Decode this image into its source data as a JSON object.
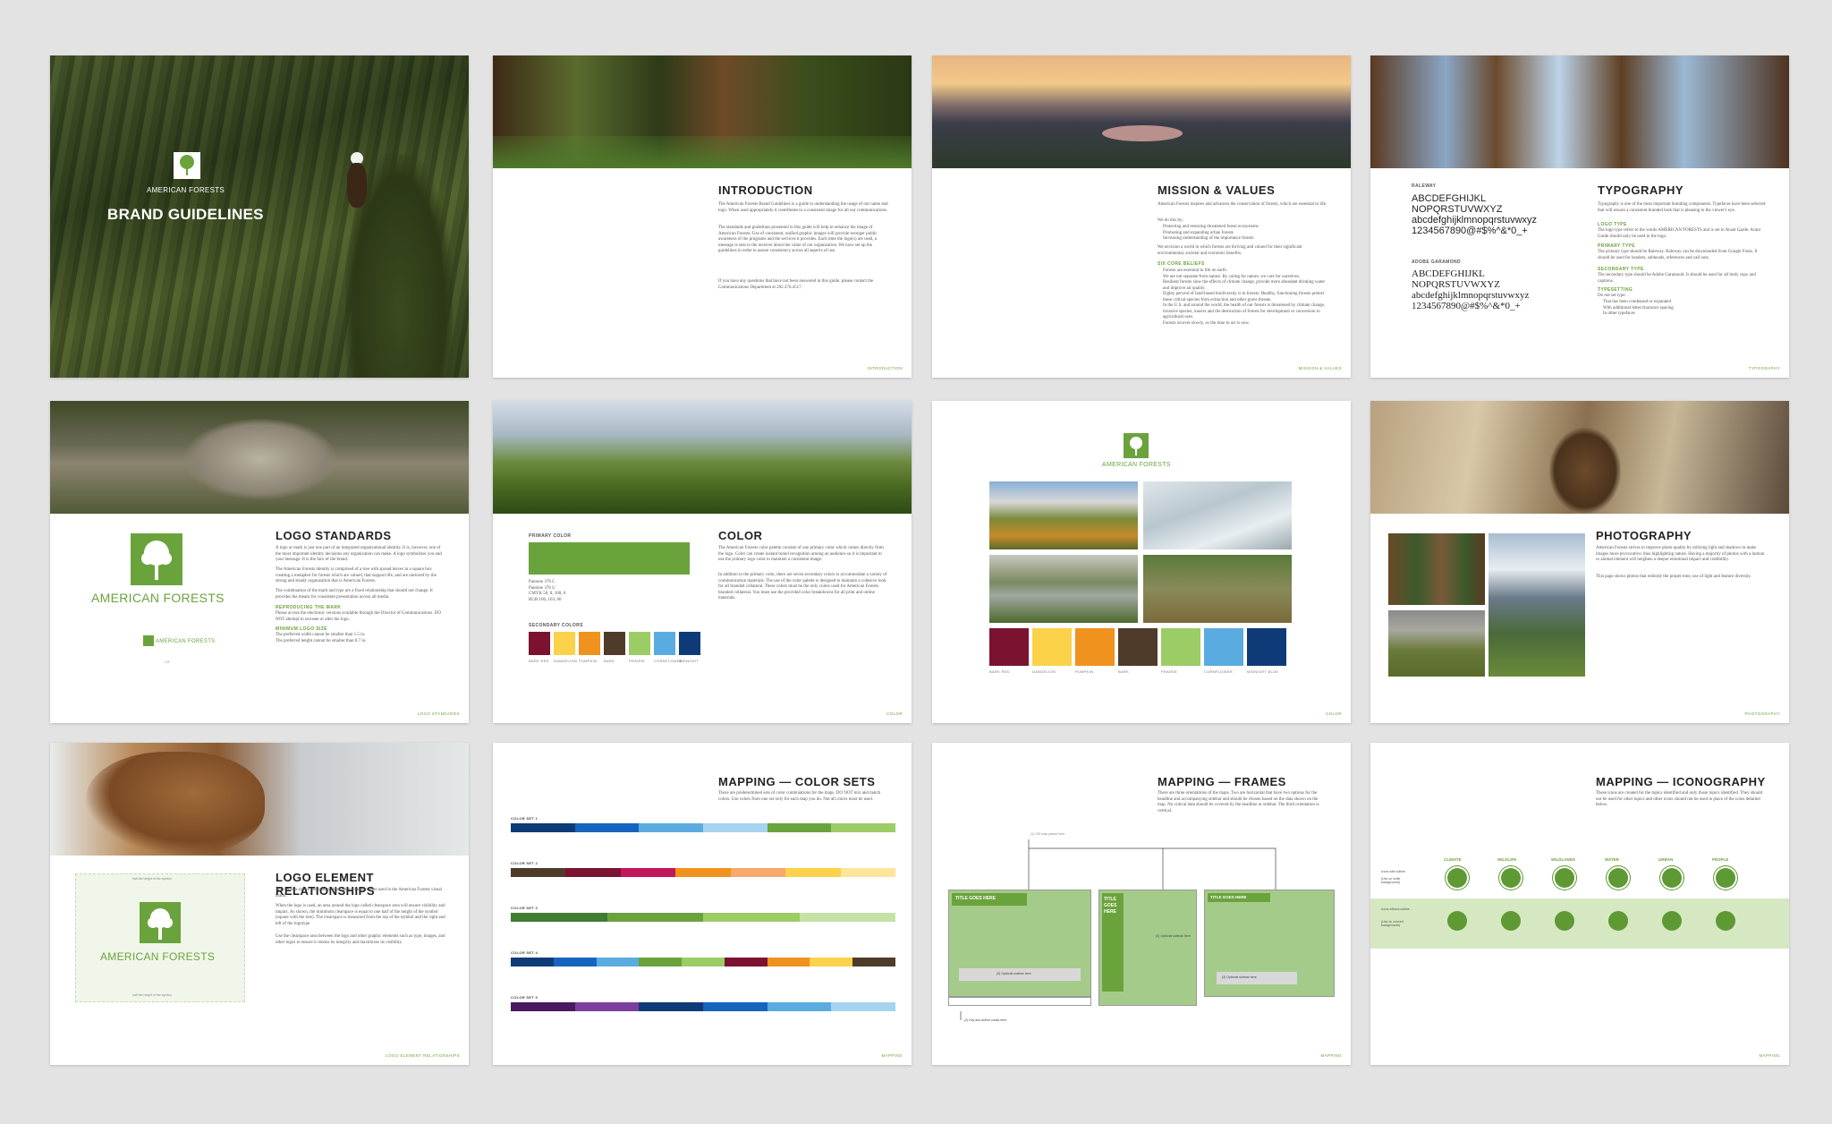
{
  "brand": "AMERICAN FORESTS",
  "cover": {
    "title": "BRAND GUIDELINES"
  },
  "intro": {
    "title": "INTRODUCTION",
    "p1": "The American Forests Brand Guidelines is a guide to understanding the usage of our name and logo. When used appropriately it contributes to a consistent image for all our communications.",
    "p2": "The standards and guidelines presented in this guide will help to enhance the image of American Forests. Use of consistent, unified graphic images will provide stronger public awareness of the programs and the services it provides. Each time the logo(s) are used, a message is sent to the receiver about the value of our organization. We have set up the guidelines in order to assure consistency across all aspects of use.",
    "p3": "If you have any questions that have not been answered in this guide, please contact the Communications Department at 202.370.4517.",
    "foot": "INTRODUCTION"
  },
  "mission": {
    "title": "MISSION & VALUES",
    "p1": "American Forests inspires and advances the conservation of forests, which are essential to life.",
    "p2": "We do this by:",
    "list1": [
      "Protecting and restoring threatened forest ecosystems",
      "Promoting and expanding urban forests",
      "Increasing understanding of the importance forests"
    ],
    "p3": "We envision a world in which forests are thriving and valued for their significant environmental, societal and economic benefits.",
    "beliefs_title": "SIX CORE BELIEFS",
    "beliefs": [
      "Forests are essential to life on earth.",
      "We are not separate from nature. By caring for nature, we care for ourselves.",
      "Resilient forests slow the effects of climate change, provide more abundant drinking water and improve air quality.",
      "Eighty percent of land-based biodiversity is in forests. Healthy, functioning forests protect these critical species from extinction and other grave threats.",
      "In the U.S. and around the world, the health of our forests is threatened by climate change, invasive species, insects and the destruction of forests for development or conversion to agricultural uses.",
      "Forests recover slowly, so the time to act is now."
    ],
    "foot": "MISSION & VALUES"
  },
  "typography": {
    "title": "TYPOGRAPHY",
    "font1_name": "RALEWAY",
    "font1_upper": "ABCDEFGHIJKL",
    "font1_upper2": "NOPQRSTUVWXYZ",
    "font1_lower": "abcdefghijklmnopqrstuvwxyz",
    "font1_nums": "1234567890@#$%^&*0_+",
    "font2_name": "ADOBE GARAMOND",
    "font2_upper": "ABCDEFGHIJKL",
    "font2_upper2": "NOPQRSTUVWXYZ",
    "font2_lower": "abcdefghijklmnopqrstuvwxyz",
    "font2_nums": "1234567890@#$%^&*0_+",
    "p1": "Typography is one of the most important branding components. Typefaces have been selected that will ensure a consistent branded look that is pleasing to the viewer's eye.",
    "logo_type": "LOGO TYPE",
    "p2": "The logo type refers to the words AMERICAN FORESTS and is set in Avant Garde. Avant Garde should only be used in the logo.",
    "primary_type": "PRIMARY TYPE",
    "p3": "The primary type should be Raleway. Raleway can be downloaded from Google Fonts. It should be used for headers, subheads, references and call outs.",
    "secondary_type": "SECONDARY TYPE",
    "p4": "The secondary type should be Adobe Garamond. It should be used for all body copy and captions.",
    "typesetting": "TYPESETTING",
    "p5": "Do not set type:",
    "list": [
      "That has been condensed or expanded",
      "With additional letter/character spacing",
      "In other typefaces"
    ],
    "foot": "TYPOGRAPHY"
  },
  "logo": {
    "title": "LOGO STANDARDS",
    "p1": "A logo or mark is just one part of an integrated organizational identity. It is, however, one of the most important identity decisions any organization can make. A logo symbolizes you and your message. It is the face of the brand.",
    "p2": "The American Forests identity is comprised of a tree with spread leaves in a square box creating a metaphor for forests which are valued, that support life, and are nurtured by the strong and steady organization that is American Forests.",
    "p3": "The combination of the mark and type are a fixed relationship that should not change. It provides the means for consistent presentation across all media.",
    "sub1": "REPRODUCING THE MARK",
    "p4": "Please access the electronic versions available through the Director of Communications. DO NOT attempt to recreate or alter the logo.",
    "sub2": "MINIMUM LOGO SIZE",
    "p5": "The preferred width cannot be smaller than 1.5 in.",
    "p6": "The preferred height cannot be smaller than 0.7 in.",
    "size_label": "1.5\"",
    "foot": "LOGO STANDARDS"
  },
  "color": {
    "title": "COLOR",
    "primary_label": "PRIMARY COLOR",
    "primary_hex": "#6aa33c",
    "primary_specs": [
      "Pantone 376 C",
      "Pantone 376 U",
      "CMYK 50, 0, 100, 0",
      "RGB 106, 163, 60"
    ],
    "p1": "The American Forests color palette consists of one primary color which comes directly from the logo. Color can create instant brand recognition among an audience so it is important to use the primary logo color to maintain a consistent image.",
    "p2": "In addition to the primary color, there are seven secondary colors to accommodate a variety of communication materials. The use of the color palette is designed to maintain a cohesive look for all branded collateral. These colors must be the only colors used for American Forests branded collateral. You must use the provided color breakdowns for all print and online materials.",
    "secondary_label": "SECONDARY COLORS",
    "swatches": [
      {
        "name": "BARK RED",
        "hex": "#7b1230"
      },
      {
        "name": "DANDELION",
        "hex": "#fbd24a"
      },
      {
        "name": "PUMPKIN",
        "hex": "#f0921e"
      },
      {
        "name": "BARK",
        "hex": "#4e3b2a"
      },
      {
        "name": "PRAIRIE",
        "hex": "#9ccc65"
      },
      {
        "name": "CORNFLOWER",
        "hex": "#5aace0"
      },
      {
        "name": "MIDNIGHT",
        "hex": "#0e3b78"
      }
    ],
    "foot": "COLOR"
  },
  "palette": {
    "brand": "AMERICAN FORESTS",
    "labels": [
      "BARK RED",
      "DANDELION",
      "PUMPKIN",
      "BARK",
      "PRAIRIE",
      "CORNFLOWER",
      "MIDNIGHT BLUE"
    ],
    "foot": "COLOR"
  },
  "photography": {
    "title": "PHOTOGRAPHY",
    "p1": "American Forests strives to improve photo quality by utilizing light and shadows to make images more provocative, thus highlighting nature. Having a majority of photos with a human or animal element will heighten a deeper emotional impact and credibility.",
    "p2": "This page shows photos that embody the proper tone, use of light and feature diversity.",
    "foot": "PHOTOGRAPHY"
  },
  "relationships": {
    "title": "LOGO ELEMENT RELATIONSHIPS",
    "half": "half the height of the symbol",
    "p1": "This section shows the relationships among the elements used in the American Forests visual brand.",
    "p2": "When the logo is used, an area around the logo called clearspace area will ensure visibility and impact. As shown, the minimum clearspace is equal to one half of the height of the symbol (square with the tree). The clearspace is measured from the top of the symbol and the right and left of the logotype.",
    "p3": "Use the clearspace area between the logo and other graphic elements such as type, images, and other logos to ensure it retains its integrity and maximizes its visibility.",
    "foot": "LOGO ELEMENT RELATIONSHIPS"
  },
  "color_sets": {
    "title": "MAPPING — COLOR SETS",
    "p1": "There are predetermined sets of color combinations for the maps. DO NOT mix and match colors. Use colors from one set only for each map you do. Not all colors must be used.",
    "sets": [
      {
        "label": "COLOR SET 1",
        "colors": [
          "#0e3b78",
          "#1565c0",
          "#5aace0",
          "#a6d4f0",
          "#6aa33c",
          "#9ccc65"
        ]
      },
      {
        "label": "COLOR SET 2",
        "colors": [
          "#4e3b2a",
          "#7b1230",
          "#c2185b",
          "#f0921e",
          "#f7a86a",
          "#fbd24a",
          "#fde59a"
        ]
      },
      {
        "label": "COLOR SET 3",
        "colors": [
          "#3e7d32",
          "#6aa33c",
          "#9ccc65",
          "#c5e1a5"
        ]
      },
      {
        "label": "COLOR SET 4",
        "colors": [
          "#0e3b78",
          "#1565c0",
          "#5aace0",
          "#6aa33c",
          "#9ccc65",
          "#7b1230",
          "#f0921e",
          "#fbd24a",
          "#4e3b2a"
        ]
      },
      {
        "label": "COLOR SET 5",
        "colors": [
          "#4a1a5e",
          "#7b3fa0",
          "#0e3b78",
          "#1565c0",
          "#5aace0",
          "#a6d4f0"
        ]
      }
    ],
    "foot": "MAPPING"
  },
  "frames": {
    "title": "MAPPING — FRAMES",
    "p1": "There are three orientations of the maps. Two are horizontal that have two options for the headline and accompanying sidebar and should be chosen based on the data shown on the map. No critical data should be covered by the headline or sidebar. The third orientation is vertical.",
    "gis": "(1) GIS map placed here",
    "frame_title": "TITLE GOES HERE",
    "frame_title_v1": "TITLE",
    "frame_title_v2": "GOES",
    "frame_title_v3": "HERE",
    "sidebar1": "(3) Optional sidebar here",
    "sidebar2": "(3) Optional sidebar here",
    "sidebar3": "(3) Optional sidebar here",
    "key": "(2) Key and author codes here",
    "foot": "MAPPING"
  },
  "iconography": {
    "title": "MAPPING — ICONOGRAPHY",
    "p1": "These icons are created for the topics identified and only those topics identified. They should not be used for other topics and other icons should not be used in place of the icons detailed below.",
    "categories": [
      "CLIMATE",
      "WILDLIFE",
      "WILDLANDS",
      "WATER",
      "URBAN",
      "PEOPLE"
    ],
    "row1_label": "Icons with outline",
    "row1_sub": "(Use on white backgrounds)",
    "row2_label": "Icons without outline",
    "row2_sub": "(Use on colored backgrounds)",
    "foot": "MAPPING"
  },
  "colors": {
    "green": "#6aa33c",
    "light_green": "#d6e8c2",
    "frame_green": "#a5cb8a"
  }
}
